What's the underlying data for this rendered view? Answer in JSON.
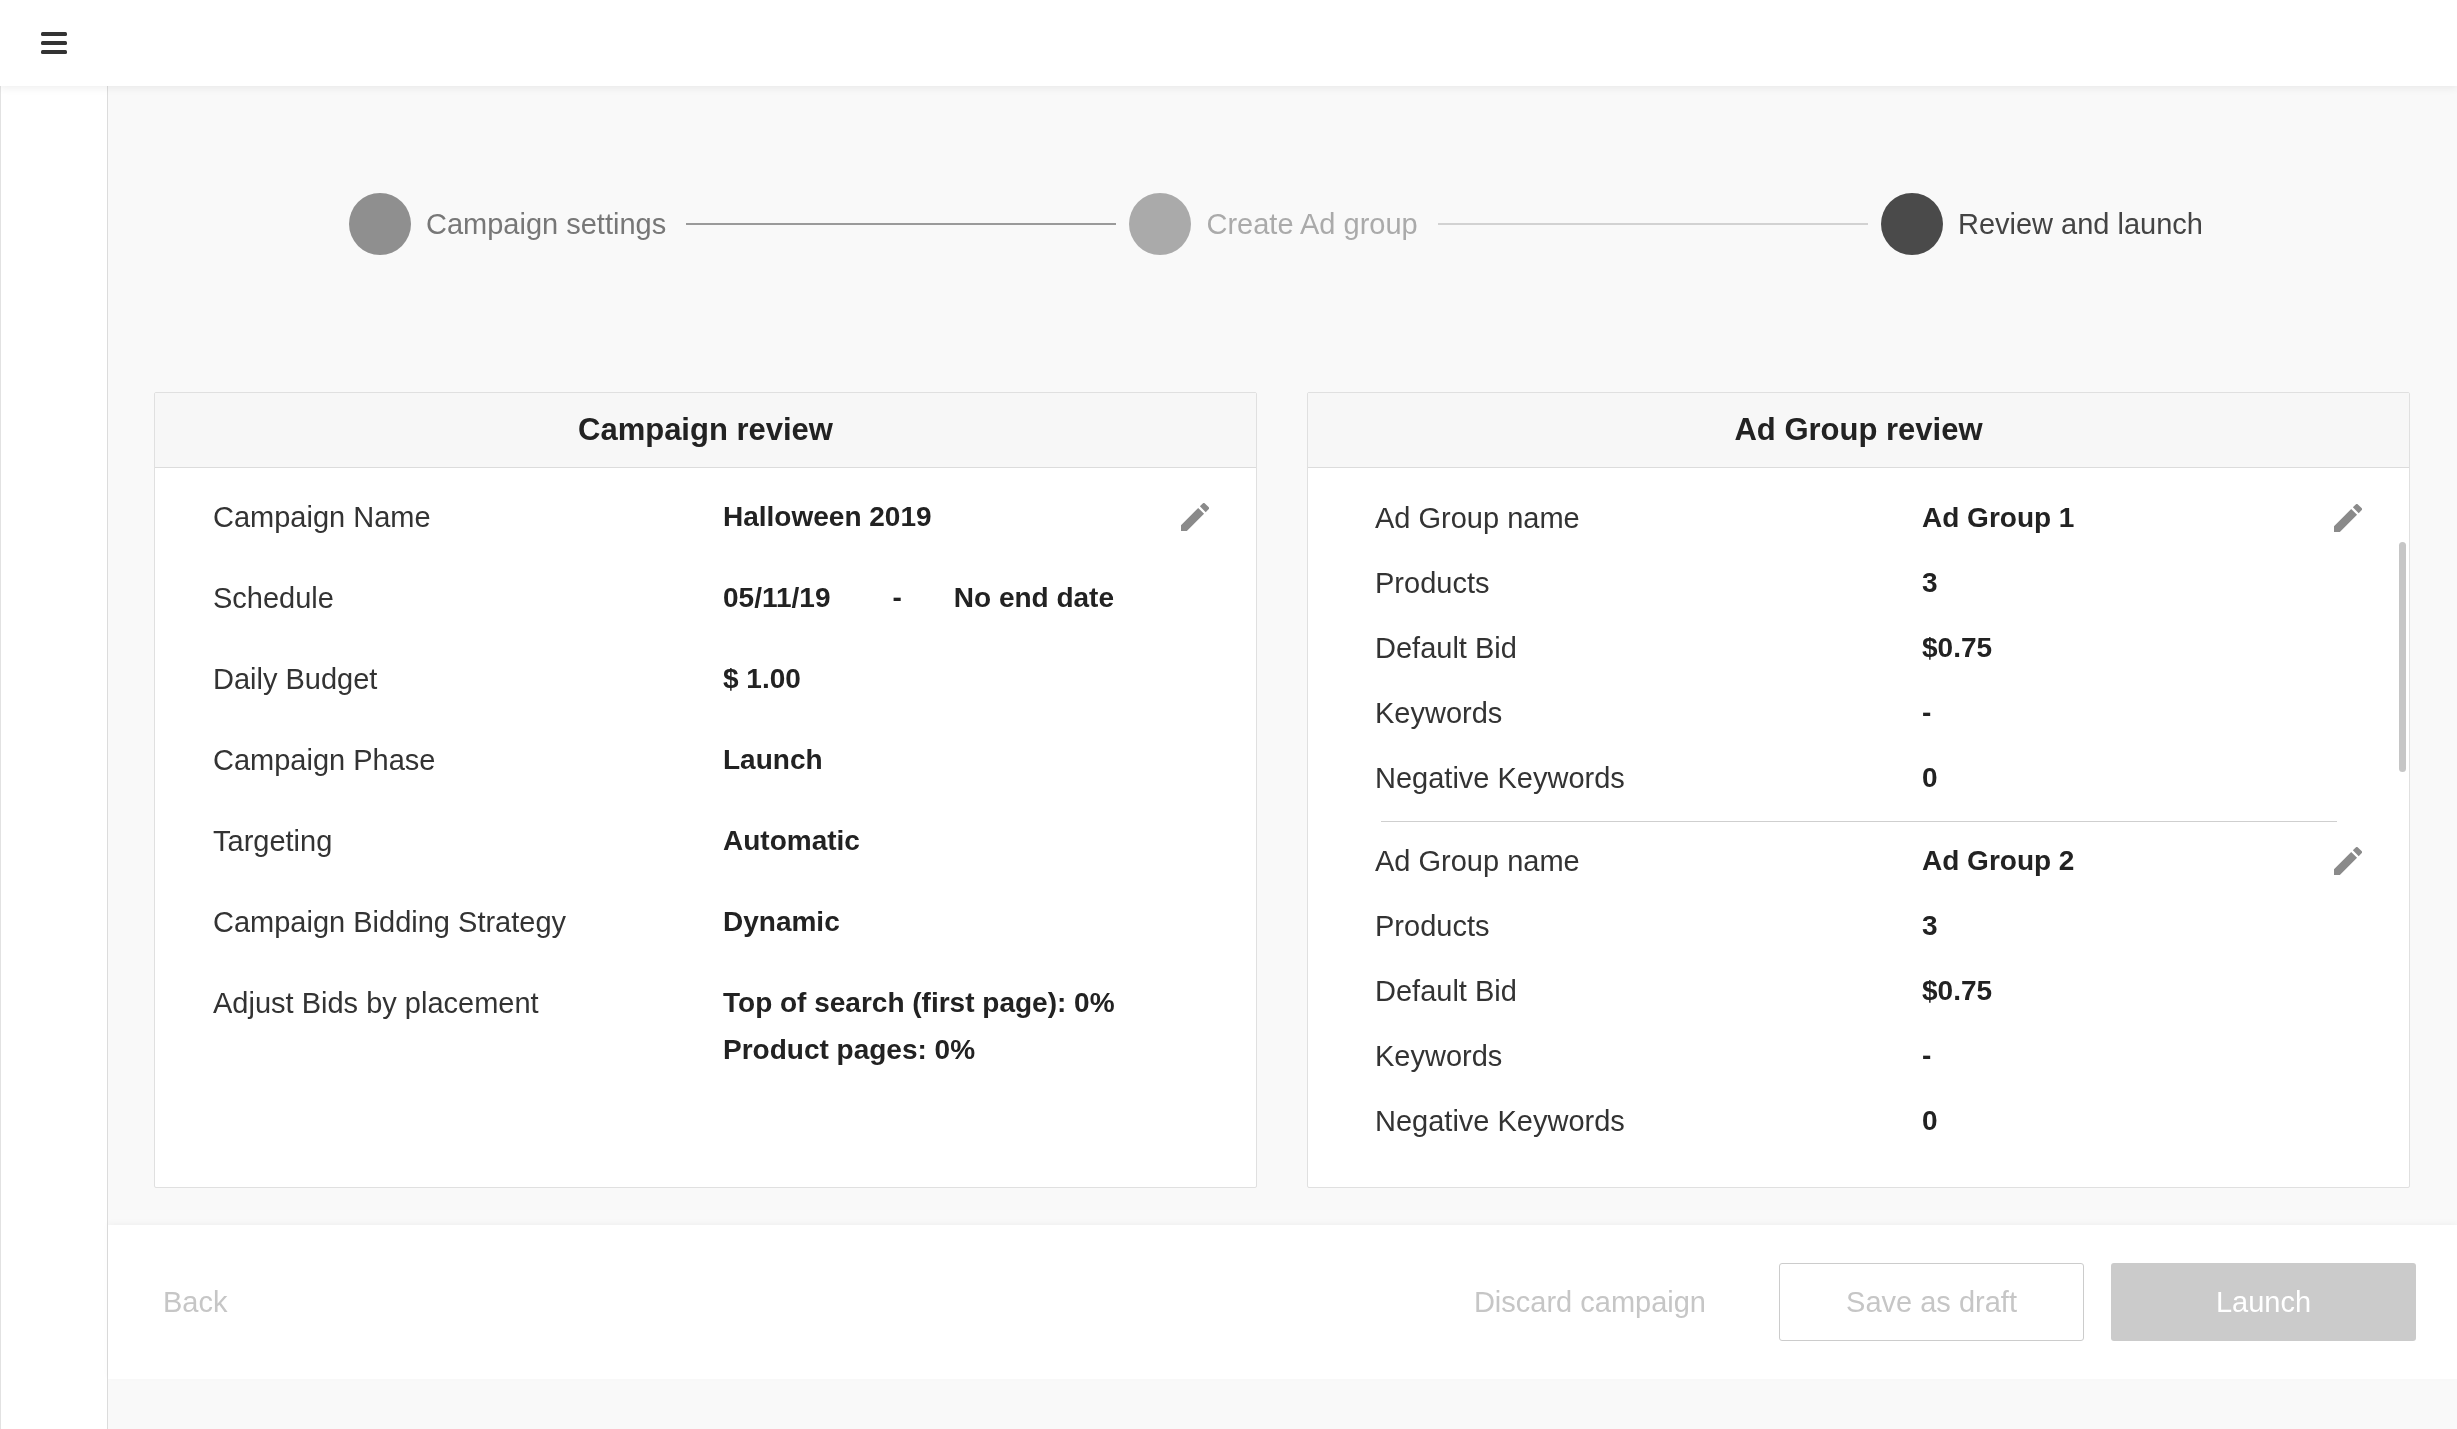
{
  "stepper": {
    "steps": [
      {
        "label": "Campaign settings",
        "selected": false,
        "completed": true
      },
      {
        "label": "Create Ad group",
        "selected": false,
        "completed": false
      },
      {
        "label": "Review and launch",
        "selected": true,
        "completed": false
      }
    ]
  },
  "campaign_review": {
    "title": "Campaign review",
    "rows": [
      {
        "kind": "text",
        "label": "Campaign Name",
        "value": "Halloween 2019"
      },
      {
        "kind": "range",
        "label": "Schedule",
        "start": "05/11/19",
        "separator": "-",
        "end": "No end date"
      },
      {
        "kind": "text",
        "label": "Daily Budget",
        "value": "$ 1.00"
      },
      {
        "kind": "text",
        "label": "Campaign Phase",
        "value": "Launch"
      },
      {
        "kind": "text",
        "label": "Targeting",
        "value": "Automatic"
      },
      {
        "kind": "text",
        "label": "Campaign Bidding Strategy",
        "value": "Dynamic"
      },
      {
        "kind": "lines",
        "label": "Adjust Bids by placement",
        "lines": [
          "Top of search (first page): 0%",
          "Product pages: 0%"
        ]
      }
    ]
  },
  "ad_group_review": {
    "title": "Ad Group review",
    "groups": [
      {
        "rows": [
          {
            "label": "Ad Group name",
            "value": "Ad Group 1"
          },
          {
            "label": "Products",
            "value": "3"
          },
          {
            "label": "Default Bid",
            "value": "$0.75"
          },
          {
            "label": "Keywords",
            "value": "-"
          },
          {
            "label": "Negative Keywords",
            "value": "0"
          }
        ]
      },
      {
        "rows": [
          {
            "label": "Ad Group name",
            "value": "Ad Group 2"
          },
          {
            "label": "Products",
            "value": "3"
          },
          {
            "label": "Default Bid",
            "value": "$0.75"
          },
          {
            "label": "Keywords",
            "value": "-"
          },
          {
            "label": "Negative Keywords",
            "value": "0"
          }
        ]
      }
    ]
  },
  "footer": {
    "back": "Back",
    "discard": "Discard campaign",
    "save_draft": "Save as draft",
    "launch": {
      "label": "Launch",
      "disabled": true
    }
  }
}
